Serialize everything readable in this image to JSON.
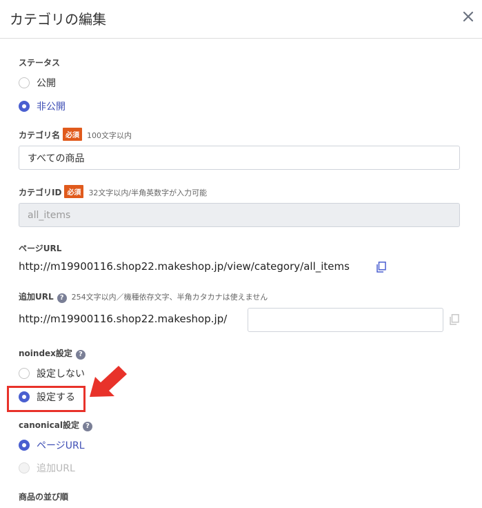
{
  "dialog": {
    "title": "カテゴリの編集",
    "close_icon": "close-icon"
  },
  "status": {
    "label": "ステータス",
    "options": [
      {
        "label": "公開",
        "selected": false
      },
      {
        "label": "非公開",
        "selected": true
      }
    ]
  },
  "category_name": {
    "label": "カテゴリ名",
    "required_badge": "必須",
    "hint": "100文字以内",
    "value": "すべての商品"
  },
  "category_id": {
    "label": "カテゴリID",
    "required_badge": "必須",
    "hint": "32文字以内/半角英数字が入力可能",
    "value": "all_items"
  },
  "page_url": {
    "label": "ページURL",
    "url": "http://m19900116.shop22.makeshop.jp/view/category/all_items"
  },
  "additional_url": {
    "label": "追加URL",
    "help": "?",
    "hint": "254文字以内／機種依存文字、半角カタカナは使えません",
    "prefix": "http://m19900116.shop22.makeshop.jp/",
    "value": ""
  },
  "noindex": {
    "label": "noindex設定",
    "help": "?",
    "options": [
      {
        "label": "設定しない",
        "selected": false
      },
      {
        "label": "設定する",
        "selected": true
      }
    ]
  },
  "canonical": {
    "label": "canonical設定",
    "help": "?",
    "options": [
      {
        "label": "ページURL",
        "selected": true
      },
      {
        "label": "追加URL",
        "selected": false,
        "disabled": true
      }
    ]
  },
  "sort_order": {
    "label": "商品の並び順"
  },
  "colors": {
    "accent": "#4a5fd0",
    "required": "#e05a1c",
    "highlight": "#e8322a"
  }
}
